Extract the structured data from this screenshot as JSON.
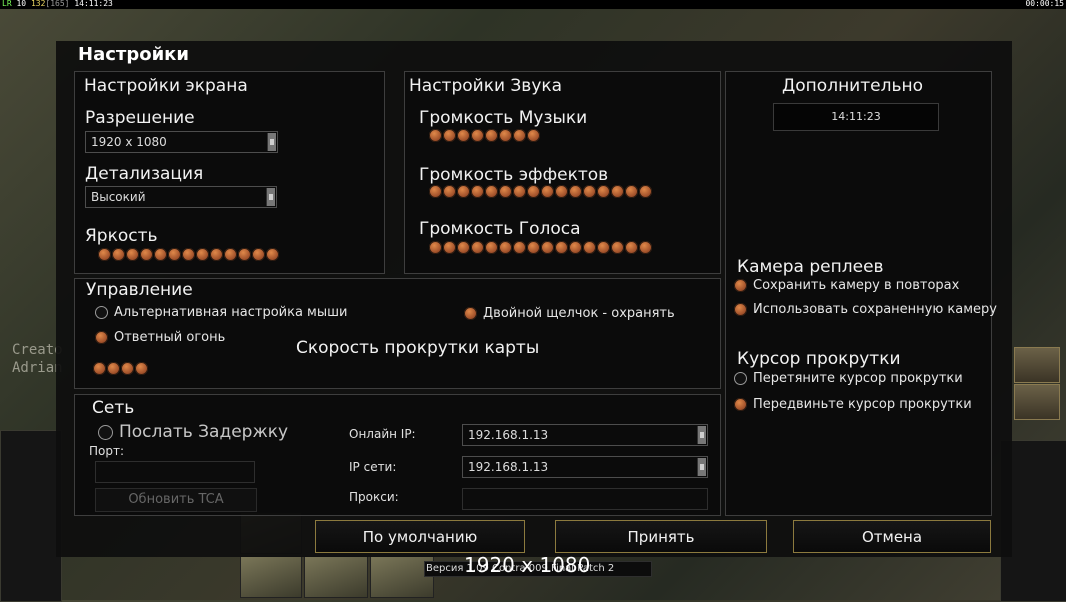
{
  "hud": {
    "fps_label": "LR",
    "fps": "10",
    "ping": "132",
    "extra": "[165]",
    "clock": "14:11:23",
    "game_time": "00:00:15"
  },
  "background": {
    "creator_line1": "Creato",
    "creator_line2": "Adrian"
  },
  "dialog": {
    "title": "Настройки"
  },
  "screen": {
    "title": "Настройки экрана",
    "resolution_label": "Разрешение",
    "resolution_value": "1920 x 1080",
    "detail_label": "Детализация",
    "detail_value": "Высокий",
    "brightness_label": "Яркость",
    "brightness_level": 13
  },
  "sound": {
    "title": "Настройки Звука",
    "music_label": "Громкость Музыки",
    "music_level": 8,
    "effects_label": "Громкость эффектов",
    "effects_level": 16,
    "voice_label": "Громкость Голоса",
    "voice_level": 16
  },
  "controls": {
    "title": "Управление",
    "alt_mouse_label": "Альтернативная настройка мыши",
    "alt_mouse_on": false,
    "return_fire_label": "Ответный огонь",
    "return_fire_on": true,
    "double_click_label": "Двойной щелчок - охранять",
    "double_click_on": true,
    "scroll_speed_label": "Скорость прокрутки карты",
    "scroll_speed_level": 4
  },
  "network": {
    "title": "Сеть",
    "send_delay_label": "Послать Задержку",
    "send_delay_on": false,
    "port_label": "Порт:",
    "update_button": "Обновить TCA",
    "online_ip_label": "Онлайн IP:",
    "online_ip_value": "192.168.1.13",
    "lan_ip_label": "IP сети:",
    "lan_ip_value": "192.168.1.13",
    "proxy_label": "Прокси:"
  },
  "extra": {
    "title": "Дополнительно",
    "clock": "14:11:23",
    "replay_camera_title": "Камера реплеев",
    "save_camera_label": "Сохранить камеру в повторах",
    "save_camera_on": true,
    "use_saved_camera_label": "Использовать сохраненную камеру",
    "use_saved_camera_on": true,
    "scroll_cursor_title": "Курсор прокрутки",
    "drag_cursor_label": "Перетяните курсор прокрутки",
    "drag_cursor_on": false,
    "move_cursor_label": "Передвиньте курсор прокрутки",
    "move_cursor_on": true
  },
  "buttons": {
    "default": "По умолчанию",
    "accept": "Принять",
    "cancel": "Отмена"
  },
  "footer": {
    "resolution": "1920 x 1080",
    "version": "Версия 1.09 Contra 009 Final Patch 2"
  },
  "colors": {
    "accent_orange": "#c8622e",
    "button_border": "#8c7a3e",
    "panel_bg": "#0e0e0e"
  }
}
